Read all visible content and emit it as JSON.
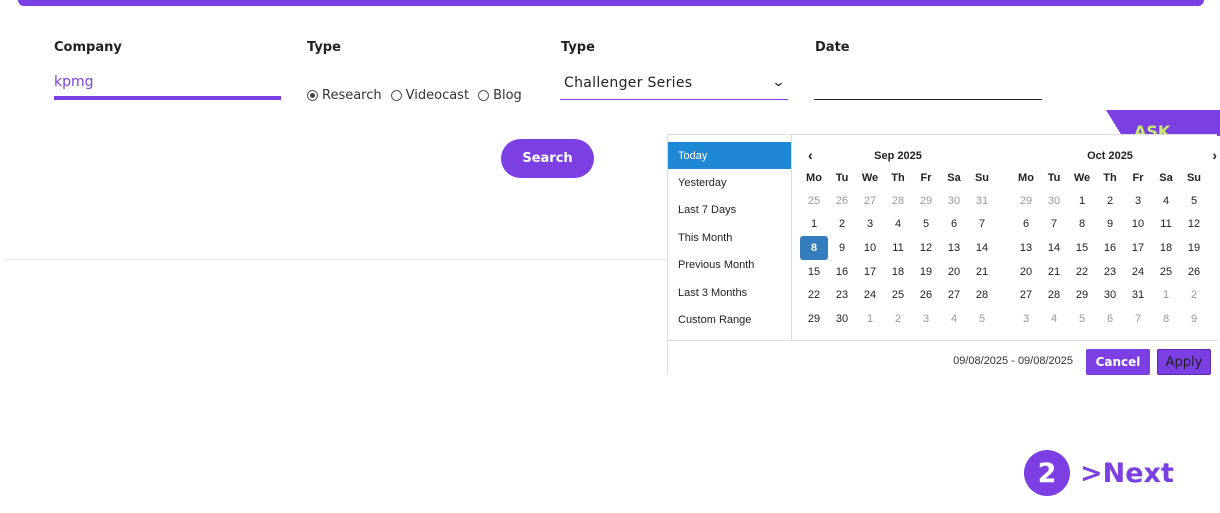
{
  "form": {
    "company_label": "Company",
    "company_value": "kpmg",
    "type_label": "Type",
    "radios": [
      {
        "label": "Research",
        "checked": true
      },
      {
        "label": "Videocast",
        "checked": false
      },
      {
        "label": "Blog",
        "checked": false
      }
    ],
    "series_label": "Type",
    "series_value": "Challenger Series",
    "date_label": "Date",
    "date_value": "",
    "search_label": "Search"
  },
  "ask_label": "ASK",
  "date_picker": {
    "ranges": [
      "Today",
      "Yesterday",
      "Last 7 Days",
      "This Month",
      "Previous Month",
      "Last 3 Months",
      "Custom Range"
    ],
    "active_range": "Today",
    "weekdays": [
      "Mo",
      "Tu",
      "We",
      "Th",
      "Fr",
      "Sa",
      "Su"
    ],
    "left_month": {
      "title": "Sep 2025",
      "days": [
        "25",
        "26",
        "27",
        "28",
        "29",
        "30",
        "31",
        "1",
        "2",
        "3",
        "4",
        "5",
        "6",
        "7",
        "8",
        "9",
        "10",
        "11",
        "12",
        "13",
        "14",
        "15",
        "16",
        "17",
        "18",
        "19",
        "20",
        "21",
        "22",
        "23",
        "24",
        "25",
        "26",
        "27",
        "28",
        "29",
        "30",
        "1",
        "2",
        "3",
        "4",
        "5"
      ],
      "off_indices": [
        0,
        1,
        2,
        3,
        4,
        5,
        6,
        37,
        38,
        39,
        40,
        41
      ],
      "selected_index": 14
    },
    "right_month": {
      "title": "Oct 2025",
      "days": [
        "29",
        "30",
        "1",
        "2",
        "3",
        "4",
        "5",
        "6",
        "7",
        "8",
        "9",
        "10",
        "11",
        "12",
        "13",
        "14",
        "15",
        "16",
        "17",
        "18",
        "19",
        "20",
        "21",
        "22",
        "23",
        "24",
        "25",
        "26",
        "27",
        "28",
        "29",
        "30",
        "31",
        "1",
        "2",
        "3",
        "4",
        "5",
        "6",
        "7",
        "8",
        "9"
      ],
      "off_indices": [
        0,
        1,
        33,
        34,
        35,
        36,
        37,
        38,
        39,
        40,
        41
      ]
    },
    "selected_range_text": "09/08/2025 - 09/08/2025",
    "cancel_label": "Cancel",
    "apply_label": "Apply"
  },
  "pagination": {
    "page": "2",
    "next_label": ">Next"
  },
  "colors": {
    "accent": "#7b3fe4",
    "range_active": "#1f88d4",
    "day_selected": "#357ebd",
    "ask_text": "#c9f06c"
  }
}
